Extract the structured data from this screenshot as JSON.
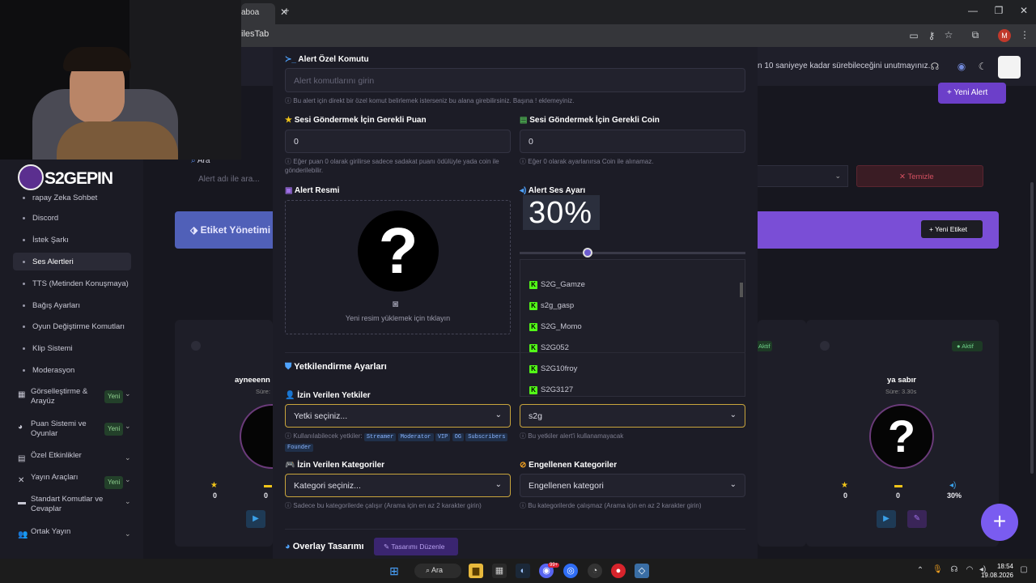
{
  "browser": {
    "tab_title": "aboa",
    "url_text": "ilesTab",
    "new_tab_glyph": "+",
    "profile_initial": "M"
  },
  "header": {
    "notice": "n 10 saniyeye kadar sürebileceğini unutmayınız.",
    "new_alert_label": "Yeni Alert"
  },
  "logo": {
    "text": "S2GEPIN"
  },
  "search": {
    "label": "Ara",
    "placeholder": "Alert adı ile ara..."
  },
  "clear_button": "Temizle",
  "tag_section": {
    "title": "Etiket Yönetimi",
    "new_tag_label": "Yeni Etiket"
  },
  "sidebar": {
    "items": [
      {
        "label": "rapay Zeka Sohbet"
      },
      {
        "label": "Discord"
      },
      {
        "label": "İstek Şarkı"
      },
      {
        "label": "Ses Alertleri"
      },
      {
        "label": "TTS (Metinden Konuşmaya)"
      },
      {
        "label": "Bağış Ayarları"
      },
      {
        "label": "Oyun Değiştirme Komutları"
      },
      {
        "label": "Klip Sistemi"
      },
      {
        "label": "Moderasyon"
      }
    ],
    "groups": [
      {
        "label": "Görselleştirme & Arayüz",
        "badge": "Yeni"
      },
      {
        "label": "Puan Sistemi ve Oyunlar",
        "badge": "Yeni"
      },
      {
        "label": "Özel Etkinlikler",
        "badge": ""
      },
      {
        "label": "Yayın Araçları",
        "badge": "Yeni"
      },
      {
        "label": "Standart Komutlar ve Cevaplar",
        "badge": ""
      },
      {
        "label": "Ortak Yayın",
        "badge": ""
      }
    ]
  },
  "modal": {
    "command": {
      "label": "Alert Özel Komutu",
      "placeholder": "Alert komutlarını girin",
      "hint": "Bu alert için direkt bir özel komut belirlemek isterseniz bu alana girebilirsiniz. Başına ! eklemeyiniz."
    },
    "points": {
      "label": "Sesi Göndermek İçin Gerekli Puan",
      "value": "0",
      "hint": "Eğer puan 0 olarak girilirse sadece sadakat puanı ödülüyle yada coin ile gönderilebilir."
    },
    "coins": {
      "label": "Sesi Göndermek İçin Gerekli Coin",
      "value": "0",
      "hint": "Eğer 0 olarak ayarlanırsa Coin ile alınamaz."
    },
    "image": {
      "label": "Alert Resmi",
      "upload_text": "Yeni resim yüklemek için tıklayın"
    },
    "volume": {
      "label": "Alert Ses Ayarı",
      "value_text": "30%",
      "level": 0.3
    },
    "user_list": [
      "S2G_Gamze",
      "s2g_gasp",
      "S2G_Momo",
      "S2G052",
      "S2G10froy",
      "S2G3127"
    ],
    "auth_section": {
      "title": "Yetkilendirme Ayarları"
    },
    "allowed_roles": {
      "label": "İzin Verilen Yetkiler",
      "placeholder": "Yetki seçiniz...",
      "hint_prefix": "Kullanılabilecek yetkiler:",
      "chips": [
        "Streamer",
        "Moderator",
        "VIP",
        "OG",
        "Subscribers",
        "Founder"
      ]
    },
    "blocked_users": {
      "value": "s2g",
      "hint": "Bu yetkiler alert'i kullanamayacak"
    },
    "allowed_categories": {
      "label": "İzin Verilen Kategoriler",
      "placeholder": "Kategori seçiniz...",
      "hint": "Sadece bu kategorilerde çalışır (Arama için en az 2 karakter girin)"
    },
    "blocked_categories": {
      "label": "Engellenen Kategoriler",
      "placeholder": "Engellenen kategori",
      "hint": "Bu kategorilerde çalışmaz (Arama için en az 2 karakter girin)"
    },
    "overlay": {
      "title": "Overlay Tasarımı",
      "edit_label": "Tasarımı Düzenle"
    }
  },
  "cards": [
    {
      "name": "ayneeenn",
      "duration": "Süre:",
      "stars": "0",
      "coins": "0",
      "status": ""
    },
    {
      "name": "",
      "duration": "",
      "stars": "",
      "coins": "",
      "status": "Aktif"
    },
    {
      "name": "ya sabır",
      "duration": "Süre: 3.30s",
      "stars": "0",
      "coins": "0",
      "volume": "30%",
      "status": "Aktif"
    }
  ],
  "taskbar": {
    "search_label": "Ara",
    "time": "18:54",
    "date": "19.08.2026",
    "badge": "99+"
  },
  "colors": {
    "accent": "#6c3fc9",
    "purple_banner": "#7a4ed6",
    "danger": "#c0394a",
    "highlight_border": "#c9a53c",
    "kick_green": "#53fc18"
  }
}
